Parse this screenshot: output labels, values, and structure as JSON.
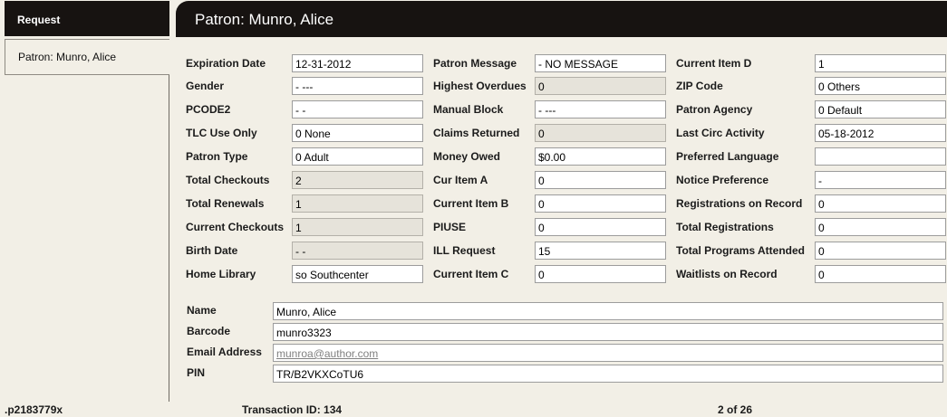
{
  "sidebar": {
    "header": "Request",
    "item": "Patron: Munro, Alice"
  },
  "title": "Patron: Munro, Alice",
  "col1": [
    {
      "label": "Expiration Date",
      "value": "12-31-2012",
      "readonly": false
    },
    {
      "label": "Gender",
      "value": "-  ---",
      "readonly": false
    },
    {
      "label": "PCODE2",
      "value": "-  -",
      "readonly": false
    },
    {
      "label": "TLC Use Only",
      "value": "0  None",
      "readonly": false
    },
    {
      "label": "Patron Type",
      "value": "0  Adult",
      "readonly": false
    },
    {
      "label": "Total Checkouts",
      "value": "2",
      "readonly": true
    },
    {
      "label": "Total Renewals",
      "value": "1",
      "readonly": true
    },
    {
      "label": "Current Checkouts",
      "value": "1",
      "readonly": true
    },
    {
      "label": "Birth Date",
      "value": "-  -",
      "readonly": true
    },
    {
      "label": "Home Library",
      "value": "so    Southcenter",
      "readonly": false
    }
  ],
  "col2": [
    {
      "label": "Patron Message",
      "value": "-  NO MESSAGE",
      "readonly": false
    },
    {
      "label": "Highest Overdues",
      "value": "0",
      "readonly": true
    },
    {
      "label": "Manual Block",
      "value": "-  ---",
      "readonly": false
    },
    {
      "label": "Claims Returned",
      "value": "0",
      "readonly": true
    },
    {
      "label": "Money Owed",
      "value": "$0.00",
      "readonly": false
    },
    {
      "label": "Cur Item A",
      "value": "0",
      "readonly": false
    },
    {
      "label": "Current Item B",
      "value": "0",
      "readonly": false
    },
    {
      "label": "PIUSE",
      "value": "0",
      "readonly": false
    },
    {
      "label": "ILL Request",
      "value": "15",
      "readonly": false
    },
    {
      "label": "Current Item C",
      "value": "0",
      "readonly": false
    }
  ],
  "col3": [
    {
      "label": "Current Item D",
      "value": "1",
      "readonly": false
    },
    {
      "label": "ZIP Code",
      "value": "0  Others",
      "readonly": false
    },
    {
      "label": "Patron Agency",
      "value": "0  Default",
      "readonly": false
    },
    {
      "label": "Last Circ Activity",
      "value": "05-18-2012",
      "readonly": false
    },
    {
      "label": "Preferred Language",
      "value": "",
      "readonly": false
    },
    {
      "label": "Notice Preference",
      "value": "-",
      "readonly": false
    },
    {
      "label": "Registrations on Record",
      "value": "0",
      "readonly": false
    },
    {
      "label": "Total Registrations",
      "value": "0",
      "readonly": false
    },
    {
      "label": "Total Programs Attended",
      "value": "0",
      "readonly": false
    },
    {
      "label": "Waitlists on Record",
      "value": "0",
      "readonly": false
    }
  ],
  "details": [
    {
      "label": "Name",
      "value": "Munro, Alice"
    },
    {
      "label": "Barcode",
      "value": "munro3323"
    },
    {
      "label": "Email Address",
      "value": "munroa@author.com"
    },
    {
      "label": "PIN",
      "value": "TR/B2VKXCoTU6"
    }
  ],
  "footer": {
    "record_id": ".p2183779x",
    "transaction": "Transaction ID:  134",
    "pager": "2 of 26"
  }
}
